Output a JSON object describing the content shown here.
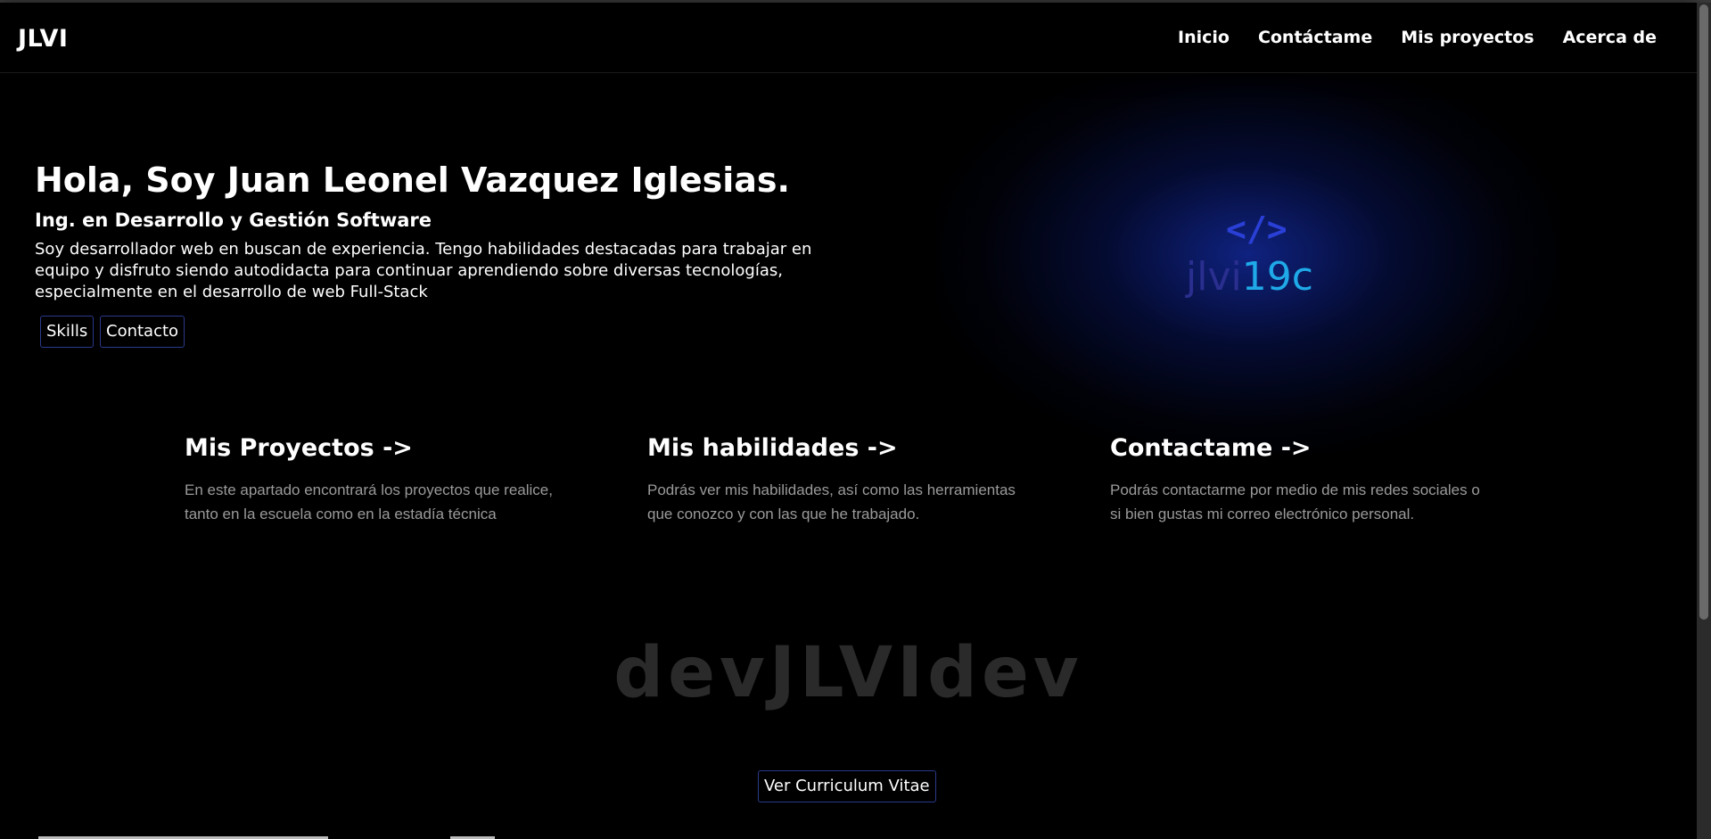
{
  "navbar": {
    "brand": "JLVI",
    "links": [
      "Inicio",
      "Contáctame",
      "Mis proyectos",
      "Acerca de"
    ]
  },
  "hero": {
    "title": "Hola, Soy Juan Leonel Vazquez Iglesias.",
    "subtitle": "Ing. en Desarrollo y Gestión Software",
    "description": "Soy desarrollador web en buscan de experiencia. Tengo habilidades destacadas para trabajar en equipo y disfruto siendo autodidacta para continuar aprendiendo sobre diversas tecnologías, especialmente en el desarrollo de web Full-Stack",
    "buttons": [
      "Skills",
      "Contacto"
    ]
  },
  "logo": {
    "tag": "</>",
    "text_a": "jlvi",
    "text_b": "19c"
  },
  "cards": [
    {
      "title": "Mis Proyectos ->",
      "text": "En este apartado encontrará los proyectos que realice, tanto en la escuela como en la estadía técnica"
    },
    {
      "title": "Mis habilidades ->",
      "text": "Podrás ver mis habilidades, así como las herramientas que conozco y con las que he trabajado."
    },
    {
      "title": "Contactame ->",
      "text": "Podrás contactarme por medio de mis redes sociales o si bien gustas mi correo electrónico personal."
    }
  ],
  "watermark": "devJLVIdev",
  "cv_button": "Ver Curriculum Vitae",
  "colors": {
    "background": "#000000",
    "glow": "#142daa",
    "button_border": "#2a3a8c",
    "logo_dark": "#2a2f8f",
    "logo_light": "#1fa9e8",
    "muted_text": "#9a9a9a"
  }
}
